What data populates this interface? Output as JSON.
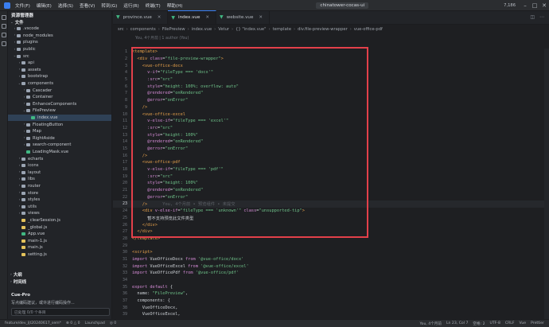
{
  "menubar": {
    "menus": [
      "文件(F)",
      "编辑(E)",
      "选择(S)",
      "查看(V)",
      "转到(G)",
      "运行(R)",
      "终端(T)",
      "帮助(H)"
    ],
    "project": "chinatower-cocas-ui",
    "right_text": "7,186"
  },
  "sidebar": {
    "title": "资源管理器",
    "section_files": "文件",
    "tree": [
      {
        "label": ".vscode",
        "type": "folder",
        "indent": 1,
        "chev": "›"
      },
      {
        "label": "node_modules",
        "type": "folder",
        "indent": 1,
        "chev": "›"
      },
      {
        "label": "plugins",
        "type": "folder",
        "indent": 1,
        "chev": "›"
      },
      {
        "label": "public",
        "type": "folder",
        "indent": 1,
        "chev": "›"
      },
      {
        "label": "src",
        "type": "folder",
        "indent": 1,
        "chev": "⌄"
      },
      {
        "label": "api",
        "type": "folder",
        "indent": 2,
        "chev": "›"
      },
      {
        "label": "assets",
        "type": "folder",
        "indent": 2,
        "chev": "›"
      },
      {
        "label": "bootstrap",
        "type": "folder",
        "indent": 2,
        "chev": "›"
      },
      {
        "label": "components",
        "type": "folder",
        "indent": 2,
        "chev": "⌄"
      },
      {
        "label": "Cascader",
        "type": "folder",
        "indent": 3,
        "chev": "›"
      },
      {
        "label": "Container",
        "type": "folder",
        "indent": 3,
        "chev": "›"
      },
      {
        "label": "EnhanceComponents",
        "type": "folder",
        "indent": 3,
        "chev": "›"
      },
      {
        "label": "FilePreview",
        "type": "folder",
        "indent": 3,
        "chev": "⌄"
      },
      {
        "label": "index.vue",
        "type": "vue",
        "indent": 4,
        "chev": "",
        "active": true
      },
      {
        "label": "FloatingButton",
        "type": "folder",
        "indent": 3,
        "chev": "›"
      },
      {
        "label": "Map",
        "type": "folder",
        "indent": 3,
        "chev": "›"
      },
      {
        "label": "RightAside",
        "type": "folder",
        "indent": 3,
        "chev": "›"
      },
      {
        "label": "search-component",
        "type": "folder",
        "indent": 3,
        "chev": "›"
      },
      {
        "label": "LoadingMask.vue",
        "type": "vue",
        "indent": 3,
        "chev": ""
      },
      {
        "label": "echarts",
        "type": "folder",
        "indent": 2,
        "chev": "›"
      },
      {
        "label": "icons",
        "type": "folder",
        "indent": 2,
        "chev": "›"
      },
      {
        "label": "layout",
        "type": "folder",
        "indent": 2,
        "chev": "›"
      },
      {
        "label": "libs",
        "type": "folder",
        "indent": 2,
        "chev": "›"
      },
      {
        "label": "router",
        "type": "folder",
        "indent": 2,
        "chev": "›"
      },
      {
        "label": "store",
        "type": "folder",
        "indent": 2,
        "chev": "›"
      },
      {
        "label": "styles",
        "type": "folder",
        "indent": 2,
        "chev": "›"
      },
      {
        "label": "utils",
        "type": "folder",
        "indent": 2,
        "chev": "›"
      },
      {
        "label": "views",
        "type": "folder",
        "indent": 2,
        "chev": "›"
      },
      {
        "label": "_clearSession.js",
        "type": "js",
        "indent": 2,
        "chev": ""
      },
      {
        "label": "_global.js",
        "type": "js",
        "indent": 2,
        "chev": ""
      },
      {
        "label": "App.vue",
        "type": "vue",
        "indent": 2,
        "chev": ""
      },
      {
        "label": "main-1.js",
        "type": "js",
        "indent": 2,
        "chev": ""
      },
      {
        "label": "main.js",
        "type": "js",
        "indent": 2,
        "chev": ""
      },
      {
        "label": "setting.js",
        "type": "js",
        "indent": 2,
        "chev": ""
      }
    ],
    "section_outline": "大纲",
    "section_timeline": "时间线",
    "cue_title": "Cue-Pro",
    "cue_text": "写点编码建议，或许进行编码操作...",
    "cue_input": "已处理 0/0 个条目"
  },
  "tabs": [
    {
      "label": "province.vue",
      "active": false
    },
    {
      "label": "index.vue",
      "active": true
    },
    {
      "label": "website.vue",
      "active": false
    }
  ],
  "breadcrumb": [
    "src",
    "components",
    "FilePreview",
    "index.vue",
    "Vetur",
    "{} \"index.vue\"",
    "template",
    "div.file-preview-wrapper",
    "vue-office-pdf"
  ],
  "author_line": "You, 4个月前 | 1 author (You)",
  "code": {
    "lines": [
      {
        "n": "1",
        "tokens": [
          [
            "<template>",
            "#e8a24b"
          ]
        ]
      },
      {
        "n": "2",
        "tokens": [
          [
            "  <div ",
            "#e8a24b"
          ],
          [
            "class",
            "#d58bd6"
          ],
          [
            "=",
            "#cfd3d8"
          ],
          [
            "\"file-preview-wrapper\"",
            "#6fc38a"
          ],
          [
            ">",
            "#e8a24b"
          ]
        ]
      },
      {
        "n": "3",
        "tokens": [
          [
            "    <vue-office-docx",
            "#e8a24b"
          ]
        ]
      },
      {
        "n": "4",
        "tokens": [
          [
            "      v-if",
            "#d58bd6"
          ],
          [
            "=",
            "#cfd3d8"
          ],
          [
            "\"fileType === 'docx'\"",
            "#6fc38a"
          ]
        ]
      },
      {
        "n": "5",
        "tokens": [
          [
            "      :src",
            "#d58bd6"
          ],
          [
            "=",
            "#cfd3d8"
          ],
          [
            "\"src\"",
            "#6fc38a"
          ]
        ]
      },
      {
        "n": "6",
        "tokens": [
          [
            "      style",
            "#d58bd6"
          ],
          [
            "=",
            "#cfd3d8"
          ],
          [
            "\"height: 100%; overflow: auto\"",
            "#6fc38a"
          ]
        ]
      },
      {
        "n": "7",
        "tokens": [
          [
            "      @rendered",
            "#d58bd6"
          ],
          [
            "=",
            "#cfd3d8"
          ],
          [
            "\"onRendered\"",
            "#6fc38a"
          ]
        ]
      },
      {
        "n": "8",
        "tokens": [
          [
            "      @error",
            "#d58bd6"
          ],
          [
            "=",
            "#cfd3d8"
          ],
          [
            "\"onError\"",
            "#6fc38a"
          ]
        ]
      },
      {
        "n": "9",
        "tokens": [
          [
            "    />",
            "#e8a24b"
          ]
        ]
      },
      {
        "n": "10",
        "tokens": [
          [
            "    <vue-office-excel",
            "#e8a24b"
          ]
        ]
      },
      {
        "n": "11",
        "tokens": [
          [
            "      v-else-if",
            "#d58bd6"
          ],
          [
            "=",
            "#cfd3d8"
          ],
          [
            "\"fileType === 'excel'\"",
            "#6fc38a"
          ]
        ]
      },
      {
        "n": "12",
        "tokens": [
          [
            "      :src",
            "#d58bd6"
          ],
          [
            "=",
            "#cfd3d8"
          ],
          [
            "\"src\"",
            "#6fc38a"
          ]
        ]
      },
      {
        "n": "13",
        "tokens": [
          [
            "      style",
            "#d58bd6"
          ],
          [
            "=",
            "#cfd3d8"
          ],
          [
            "\"height: 100%\"",
            "#6fc38a"
          ]
        ]
      },
      {
        "n": "14",
        "tokens": [
          [
            "      @rendered",
            "#d58bd6"
          ],
          [
            "=",
            "#cfd3d8"
          ],
          [
            "\"onRendered\"",
            "#6fc38a"
          ]
        ]
      },
      {
        "n": "15",
        "tokens": [
          [
            "      @error",
            "#d58bd6"
          ],
          [
            "=",
            "#cfd3d8"
          ],
          [
            "\"onError\"",
            "#6fc38a"
          ]
        ]
      },
      {
        "n": "16",
        "tokens": [
          [
            "    />",
            "#e8a24b"
          ]
        ]
      },
      {
        "n": "17",
        "tokens": [
          [
            "    <vue-office-pdf",
            "#e8a24b"
          ]
        ]
      },
      {
        "n": "18",
        "tokens": [
          [
            "      v-else-if",
            "#d58bd6"
          ],
          [
            "=",
            "#cfd3d8"
          ],
          [
            "\"fileType === 'pdf'\"",
            "#6fc38a"
          ]
        ]
      },
      {
        "n": "19",
        "tokens": [
          [
            "      :src",
            "#d58bd6"
          ],
          [
            "=",
            "#cfd3d8"
          ],
          [
            "\"src\"",
            "#6fc38a"
          ]
        ]
      },
      {
        "n": "20",
        "tokens": [
          [
            "      style",
            "#d58bd6"
          ],
          [
            "=",
            "#cfd3d8"
          ],
          [
            "\"height: 100%\"",
            "#6fc38a"
          ]
        ]
      },
      {
        "n": "21",
        "tokens": [
          [
            "      @rendered",
            "#d58bd6"
          ],
          [
            "=",
            "#cfd3d8"
          ],
          [
            "\"onRendered\"",
            "#6fc38a"
          ]
        ]
      },
      {
        "n": "22",
        "tokens": [
          [
            "      @error",
            "#d58bd6"
          ],
          [
            "=",
            "#cfd3d8"
          ],
          [
            "\"onError\"",
            "#6fc38a"
          ]
        ]
      },
      {
        "n": "23",
        "tokens": [
          [
            "    />",
            "#e8a24b"
          ],
          [
            "      You, 4个月前 • 预览组件 • 未提交",
            "#5d6168"
          ]
        ],
        "current": true
      },
      {
        "n": "24",
        "tokens": [
          [
            "    <div ",
            "#e8a24b"
          ],
          [
            "v-else-if",
            "#d58bd6"
          ],
          [
            "=",
            "#cfd3d8"
          ],
          [
            "\"fileType === 'unknown'\"",
            "#6fc38a"
          ],
          [
            " class",
            "#d58bd6"
          ],
          [
            "=",
            "#cfd3d8"
          ],
          [
            "\"unsupported-tip\"",
            "#6fc38a"
          ],
          [
            ">",
            "#e8a24b"
          ]
        ]
      },
      {
        "n": "25",
        "tokens": [
          [
            "      暂不支持预览此文件类型",
            "#cfd3d8"
          ]
        ]
      },
      {
        "n": "26",
        "tokens": [
          [
            "    </div>",
            "#e8a24b"
          ]
        ]
      },
      {
        "n": "27",
        "tokens": [
          [
            "  </div>",
            "#e8a24b"
          ]
        ]
      },
      {
        "n": "28",
        "tokens": [
          [
            "</template>",
            "#e8a24b"
          ]
        ]
      },
      {
        "n": "29",
        "tokens": [
          [
            "",
            "#cfd3d8"
          ]
        ]
      },
      {
        "n": "30",
        "tokens": [
          [
            "<script>",
            "#e8a24b"
          ]
        ]
      },
      {
        "n": "31",
        "tokens": [
          [
            "import ",
            "#d58bd6"
          ],
          [
            "VueOfficeDocx ",
            "#cfd3d8"
          ],
          [
            "from ",
            "#d58bd6"
          ],
          [
            "'@vue-office/docx'",
            "#6fc38a"
          ]
        ]
      },
      {
        "n": "32",
        "tokens": [
          [
            "import ",
            "#d58bd6"
          ],
          [
            "VueOfficeExcel ",
            "#cfd3d8"
          ],
          [
            "from ",
            "#d58bd6"
          ],
          [
            "'@vue-office/excel'",
            "#6fc38a"
          ]
        ]
      },
      {
        "n": "33",
        "tokens": [
          [
            "import ",
            "#d58bd6"
          ],
          [
            "VueOfficePdf ",
            "#cfd3d8"
          ],
          [
            "from ",
            "#d58bd6"
          ],
          [
            "'@vue-office/pdf'",
            "#6fc38a"
          ]
        ]
      },
      {
        "n": "34",
        "tokens": [
          [
            "",
            "#cfd3d8"
          ]
        ]
      },
      {
        "n": "35",
        "tokens": [
          [
            "export default ",
            "#d58bd6"
          ],
          [
            "{",
            "#cfd3d8"
          ]
        ]
      },
      {
        "n": "36",
        "tokens": [
          [
            "  name: ",
            "#cfd3d8"
          ],
          [
            "\"FilePreview\"",
            "#6fc38a"
          ],
          [
            ",",
            "#cfd3d8"
          ]
        ]
      },
      {
        "n": "37",
        "tokens": [
          [
            "  components: {",
            "#cfd3d8"
          ]
        ]
      },
      {
        "n": "38",
        "tokens": [
          [
            "    VueOfficeDocx,",
            "#cfd3d8"
          ]
        ]
      },
      {
        "n": "39",
        "tokens": [
          [
            "    VueOfficeExcel,",
            "#cfd3d8"
          ]
        ]
      }
    ]
  },
  "statusbar": {
    "left": [
      "feature/dev_ljt20240617_sem*",
      "⊗ 0 △ 0",
      "Launchpad",
      "◎ 0"
    ],
    "right": [
      "You, 4个月前",
      "Ln 23, Col 7",
      "空格: 2",
      "UTF-8",
      "CRLF",
      "Vue",
      "Prettier"
    ]
  }
}
